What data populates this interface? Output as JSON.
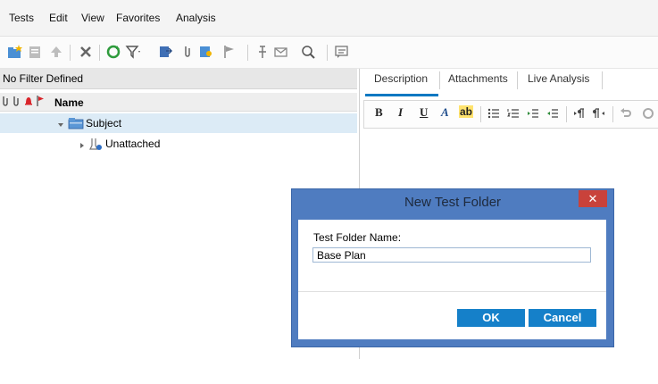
{
  "menu": [
    "Tests",
    "Edit",
    "View",
    "Favorites",
    "Analysis"
  ],
  "left": {
    "filter": "No Filter Defined",
    "column_name": "Name",
    "tree": [
      {
        "label": "Subject"
      },
      {
        "label": "Unattached"
      }
    ]
  },
  "tabs": [
    "Description",
    "Attachments",
    "Live Analysis"
  ],
  "rich_text": {
    "bold": "B",
    "italic": "I",
    "underline": "U",
    "font": "A",
    "highlight": "ab"
  },
  "dialog": {
    "title": "New Test Folder",
    "close": "✕",
    "label": "Test Folder Name:",
    "value": "Base Plan",
    "ok": "OK",
    "cancel": "Cancel"
  },
  "colors": {
    "accent": "#1580c9",
    "dialog_frame": "#4f7cc0",
    "close": "#c9423b",
    "selection": "#dcebf6"
  }
}
